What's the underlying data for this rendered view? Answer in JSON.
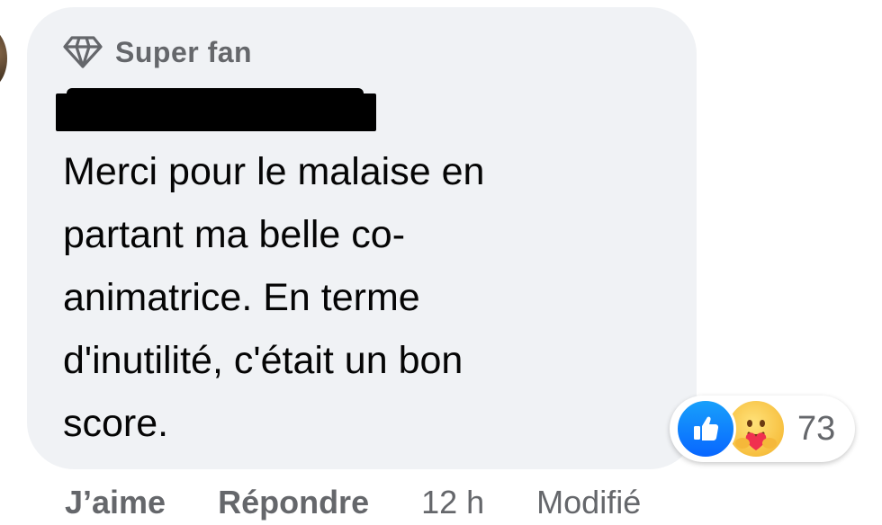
{
  "comment": {
    "badge_label": "Super fan",
    "badge_icon": "diamond-icon",
    "author_redacted": true,
    "lines": [
      "Merci pour le malaise en",
      "partant ma belle co-",
      "animatrice. En terme",
      "d'inutilité, c'était un bon",
      "score."
    ]
  },
  "reactions": {
    "icons": [
      "like-icon",
      "care-icon"
    ],
    "count": "73",
    "colors": {
      "like": "#0866ff",
      "care": "#f7c040"
    }
  },
  "actions": {
    "like": "J’aime",
    "reply": "Répondre",
    "time": "12 h",
    "edited": "Modifié"
  },
  "colors": {
    "bubble": "#f0f2f5",
    "secondary_text": "#65676b",
    "primary_text": "#050505"
  }
}
